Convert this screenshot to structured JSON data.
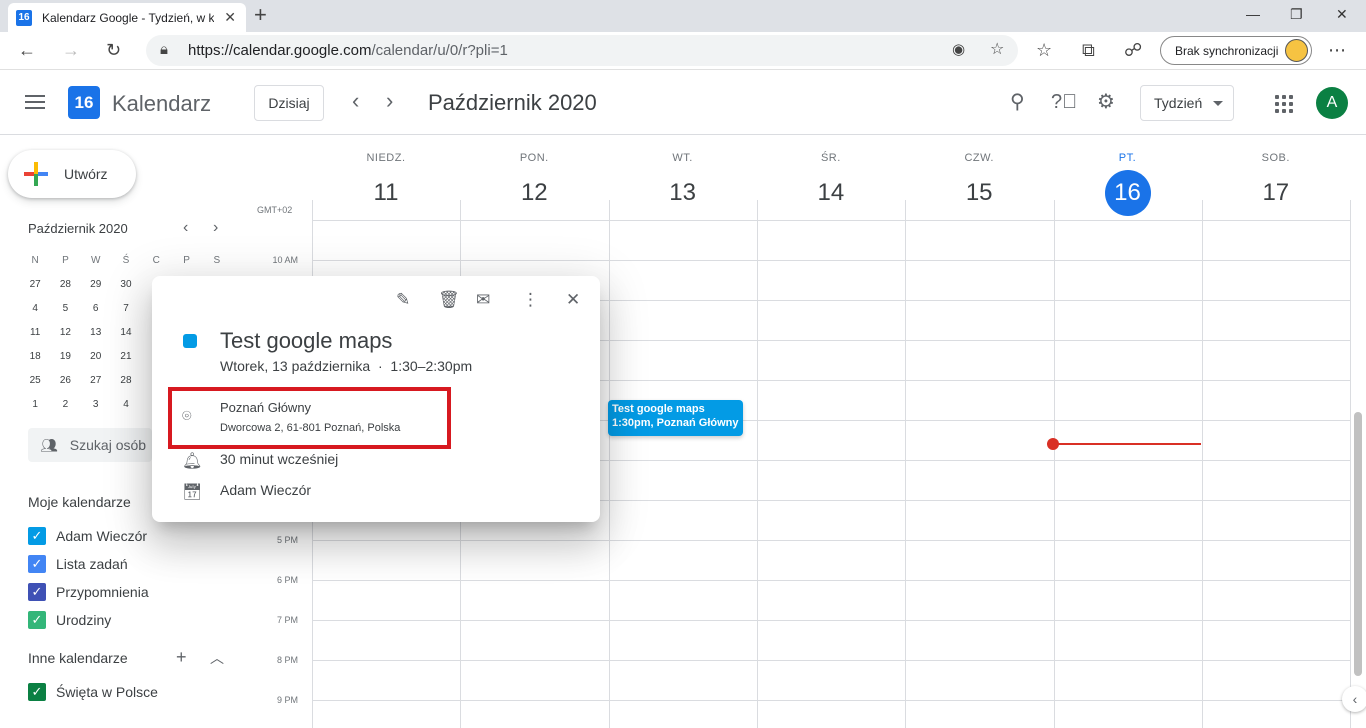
{
  "browser": {
    "tab_title": "Kalendarz Google - Tydzień, w któ",
    "tab_icon_day": "16",
    "url_main": "https://calendar.google.com",
    "url_rest": "/calendar/u/0/r?pli=1",
    "sync_label": "Brak synchronizacji"
  },
  "header": {
    "logo_day": "16",
    "brand": "Kalendarz",
    "today_label": "Dzisiaj",
    "month_title": "Październik 2020",
    "view_label": "Tydzień",
    "avatar_letter": "A"
  },
  "sidebar": {
    "create_label": "Utwórz",
    "mini_title": "Październik 2020",
    "mini_head": [
      "N",
      "P",
      "W",
      "Ś",
      "C",
      "P",
      "S"
    ],
    "mini_rows": [
      [
        "27",
        "28",
        "29",
        "30",
        "",
        "",
        ""
      ],
      [
        "4",
        "5",
        "6",
        "7",
        "",
        "",
        ""
      ],
      [
        "11",
        "12",
        "13",
        "14",
        "",
        "",
        ""
      ],
      [
        "18",
        "19",
        "20",
        "21",
        "",
        "",
        ""
      ],
      [
        "25",
        "26",
        "27",
        "28",
        "",
        "",
        ""
      ],
      [
        "1",
        "2",
        "3",
        "4",
        "",
        "",
        ""
      ]
    ],
    "search_people": "Szukaj osób",
    "my_calendars_title": "Moje kalendarze",
    "my_calendars": [
      {
        "label": "Adam Wieczór",
        "color": "#039be5"
      },
      {
        "label": "Lista zadań",
        "color": "#4285f4"
      },
      {
        "label": "Przypomnienia",
        "color": "#3f51b5"
      },
      {
        "label": "Urodziny",
        "color": "#33b679"
      }
    ],
    "other_calendars_title": "Inne kalendarze",
    "other_calendars": [
      {
        "label": "Święta w Polsce",
        "color": "#0b8043"
      }
    ]
  },
  "week": {
    "timezone": "GMT+02",
    "days": [
      {
        "dow": "NIEDZ.",
        "dom": "11"
      },
      {
        "dow": "PON.",
        "dom": "12"
      },
      {
        "dow": "WT.",
        "dom": "13"
      },
      {
        "dow": "ŚR.",
        "dom": "14"
      },
      {
        "dow": "CZW.",
        "dom": "15"
      },
      {
        "dow": "PT.",
        "dom": "16"
      },
      {
        "dow": "SOB.",
        "dom": "17"
      }
    ],
    "hours": [
      "10 AM",
      "5 PM",
      "6 PM",
      "7 PM",
      "8 PM",
      "9 PM"
    ],
    "event": {
      "title": "Test google maps",
      "detail": "1:30pm, Poznań Główny"
    }
  },
  "popup": {
    "title": "Test google maps",
    "date": "Wtorek, 13 października",
    "time": "1:30–2:30pm",
    "location_name": "Poznań Główny",
    "location_address": "Dworcowa 2, 61-801 Poznań, Polska",
    "reminder": "30 minut wcześniej",
    "calendar_owner": "Adam Wieczór"
  },
  "colors": {
    "accent": "#1a73e8",
    "event": "#039be5",
    "now_line": "#d93025",
    "highlight_box": "#d71920"
  }
}
